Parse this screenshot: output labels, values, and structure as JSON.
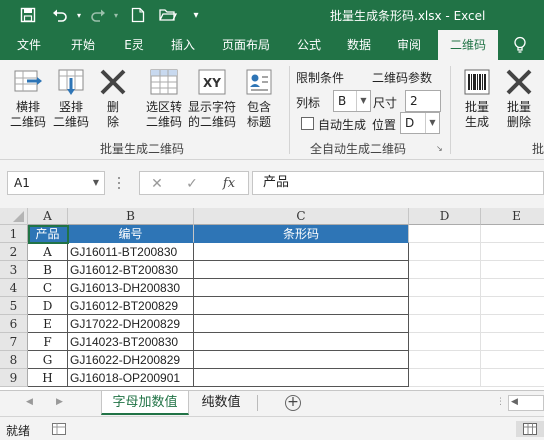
{
  "window": {
    "title": "批量生成条形码.xlsx - Excel"
  },
  "tabs": [
    {
      "label": "文件"
    },
    {
      "label": "开始"
    },
    {
      "label": "E灵"
    },
    {
      "label": "插入"
    },
    {
      "label": "页面布局"
    },
    {
      "label": "公式"
    },
    {
      "label": "数据"
    },
    {
      "label": "审阅"
    },
    {
      "label": "二维码",
      "active": true
    }
  ],
  "ribbon": {
    "batch_group": {
      "label": "批量生成二维码",
      "buttons": [
        {
          "line1": "横排",
          "line2": "二维码"
        },
        {
          "line1": "竖排",
          "line2": "二维码"
        },
        {
          "line1": "删",
          "line2": "除"
        },
        {
          "line1": "选区转",
          "line2": "二维码"
        },
        {
          "line1": "显示字符",
          "line2": "的二维码"
        },
        {
          "line1": "包含",
          "line2": "标题"
        }
      ]
    },
    "auto_group": {
      "label": "全自动生成二维码",
      "limit_label": "限制条件",
      "params_label": "二维码参数",
      "column_label": "列标",
      "column_value": "B",
      "size_label": "尺寸",
      "size_value": "2",
      "auto_label": "自动生成",
      "position_label": "位置",
      "position_value": "D"
    },
    "barcode_group": {
      "buttons": [
        {
          "line1": "批量",
          "line2": "生成"
        },
        {
          "line1": "批量",
          "line2": "删除"
        }
      ],
      "label_partial": "批"
    }
  },
  "formula_bar": {
    "name_box": "A1",
    "formula": "产品"
  },
  "grid": {
    "columns": [
      "A",
      "B",
      "C",
      "D",
      "E"
    ],
    "rows": [
      "1",
      "2",
      "3",
      "4",
      "5",
      "6",
      "7",
      "8",
      "9"
    ],
    "header": [
      "产品",
      "编号",
      "条形码"
    ],
    "data": [
      [
        "A",
        "GJ16011-BT200830"
      ],
      [
        "B",
        "GJ16012-BT200830"
      ],
      [
        "C",
        "GJ16013-DH200830"
      ],
      [
        "D",
        "GJ16012-BT200829"
      ],
      [
        "E",
        "GJ17022-DH200829"
      ],
      [
        "F",
        "GJ14023-BT200830"
      ],
      [
        "G",
        "GJ16022-DH200829"
      ],
      [
        "H",
        "GJ16018-OP200901"
      ]
    ]
  },
  "sheets": [
    {
      "label": "字母加数值",
      "active": true
    },
    {
      "label": "纯数值"
    }
  ],
  "status": {
    "text": "就绪"
  },
  "colors": {
    "brand": "#217346",
    "header_fill": "#2e75b6"
  }
}
